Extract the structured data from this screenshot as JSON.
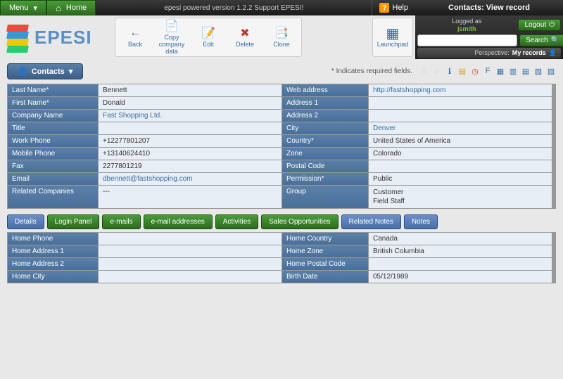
{
  "topbar": {
    "menu": "Menu",
    "home": "Home",
    "powered": "epesi powered  version 1.2.2   Support EPESI!",
    "help": "Help",
    "breadcrumb": "Contacts: View record"
  },
  "logo": "EPESI",
  "toolbar": {
    "back": "Back",
    "copy": "Copy company data",
    "edit": "Edit",
    "delete": "Delete",
    "clone": "Clone"
  },
  "launchpad": "Launchpad",
  "user": {
    "logged_as": "Logged as",
    "username": "jsmith",
    "logout": "Logout",
    "search": "Search",
    "perspective_label": "Perspective:",
    "perspective_value": "My records"
  },
  "section": {
    "title": "Contacts",
    "required_note": "* Indicates required fields."
  },
  "fields": {
    "last_name_l": "Last Name*",
    "last_name_v": "Bennett",
    "web_l": "Web address",
    "web_v": "http://fastshopping.com",
    "first_name_l": "First Name*",
    "first_name_v": "Donald",
    "addr1_l": "Address 1",
    "addr1_v": "",
    "company_l": "Company Name",
    "company_v": "Fast Shopping Ltd.",
    "addr2_l": "Address 2",
    "addr2_v": "",
    "title_l": "Title",
    "title_v": "",
    "city_l": "City",
    "city_v": "Denver",
    "wphone_l": "Work Phone",
    "wphone_v": "+12277801207",
    "country_l": "Country*",
    "country_v": "United States of America",
    "mphone_l": "Mobile Phone",
    "mphone_v": "+13140624410",
    "zone_l": "Zone",
    "zone_v": "Colorado",
    "fax_l": "Fax",
    "fax_v": "2277801219",
    "postal_l": "Postal Code",
    "postal_v": "",
    "email_l": "Email",
    "email_v": "dbennett@fastshopping.com",
    "perm_l": "Permission*",
    "perm_v": "Public",
    "related_l": "Related Companies",
    "related_v": "---",
    "group_l": "Group",
    "group_v": "Customer\nField Staff"
  },
  "tabs": [
    "Details",
    "Login Panel",
    "e-mails",
    "e-mail addresses",
    "Activities",
    "Sales Opportunities",
    "Related Notes",
    "Notes"
  ],
  "details": {
    "hphone_l": "Home Phone",
    "hphone_v": "",
    "hcountry_l": "Home Country",
    "hcountry_v": "Canada",
    "haddr1_l": "Home Address 1",
    "haddr1_v": "",
    "hzone_l": "Home Zone",
    "hzone_v": "British Columbia",
    "haddr2_l": "Home Address 2",
    "haddr2_v": "",
    "hpostal_l": "Home Postal Code",
    "hpostal_v": "",
    "hcity_l": "Home City",
    "hcity_v": "",
    "birth_l": "Birth Date",
    "birth_v": "05/12/1989"
  }
}
